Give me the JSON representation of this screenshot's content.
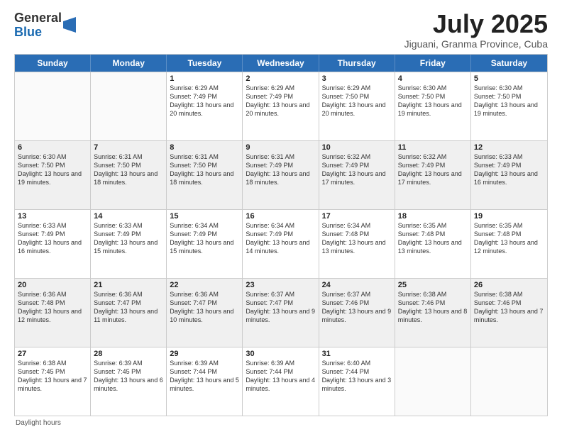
{
  "logo": {
    "general": "General",
    "blue": "Blue"
  },
  "title": "July 2025",
  "location": "Jiguani, Granma Province, Cuba",
  "days_of_week": [
    "Sunday",
    "Monday",
    "Tuesday",
    "Wednesday",
    "Thursday",
    "Friday",
    "Saturday"
  ],
  "footer_text": "Daylight hours",
  "weeks": [
    [
      {
        "day": "",
        "sunrise": "",
        "sunset": "",
        "daylight": "",
        "shaded": false,
        "empty": true
      },
      {
        "day": "",
        "sunrise": "",
        "sunset": "",
        "daylight": "",
        "shaded": false,
        "empty": true
      },
      {
        "day": "1",
        "sunrise": "Sunrise: 6:29 AM",
        "sunset": "Sunset: 7:49 PM",
        "daylight": "Daylight: 13 hours and 20 minutes.",
        "shaded": false,
        "empty": false
      },
      {
        "day": "2",
        "sunrise": "Sunrise: 6:29 AM",
        "sunset": "Sunset: 7:49 PM",
        "daylight": "Daylight: 13 hours and 20 minutes.",
        "shaded": false,
        "empty": false
      },
      {
        "day": "3",
        "sunrise": "Sunrise: 6:29 AM",
        "sunset": "Sunset: 7:50 PM",
        "daylight": "Daylight: 13 hours and 20 minutes.",
        "shaded": false,
        "empty": false
      },
      {
        "day": "4",
        "sunrise": "Sunrise: 6:30 AM",
        "sunset": "Sunset: 7:50 PM",
        "daylight": "Daylight: 13 hours and 19 minutes.",
        "shaded": false,
        "empty": false
      },
      {
        "day": "5",
        "sunrise": "Sunrise: 6:30 AM",
        "sunset": "Sunset: 7:50 PM",
        "daylight": "Daylight: 13 hours and 19 minutes.",
        "shaded": false,
        "empty": false
      }
    ],
    [
      {
        "day": "6",
        "sunrise": "Sunrise: 6:30 AM",
        "sunset": "Sunset: 7:50 PM",
        "daylight": "Daylight: 13 hours and 19 minutes.",
        "shaded": true,
        "empty": false
      },
      {
        "day": "7",
        "sunrise": "Sunrise: 6:31 AM",
        "sunset": "Sunset: 7:50 PM",
        "daylight": "Daylight: 13 hours and 18 minutes.",
        "shaded": true,
        "empty": false
      },
      {
        "day": "8",
        "sunrise": "Sunrise: 6:31 AM",
        "sunset": "Sunset: 7:50 PM",
        "daylight": "Daylight: 13 hours and 18 minutes.",
        "shaded": true,
        "empty": false
      },
      {
        "day": "9",
        "sunrise": "Sunrise: 6:31 AM",
        "sunset": "Sunset: 7:49 PM",
        "daylight": "Daylight: 13 hours and 18 minutes.",
        "shaded": true,
        "empty": false
      },
      {
        "day": "10",
        "sunrise": "Sunrise: 6:32 AM",
        "sunset": "Sunset: 7:49 PM",
        "daylight": "Daylight: 13 hours and 17 minutes.",
        "shaded": true,
        "empty": false
      },
      {
        "day": "11",
        "sunrise": "Sunrise: 6:32 AM",
        "sunset": "Sunset: 7:49 PM",
        "daylight": "Daylight: 13 hours and 17 minutes.",
        "shaded": true,
        "empty": false
      },
      {
        "day": "12",
        "sunrise": "Sunrise: 6:33 AM",
        "sunset": "Sunset: 7:49 PM",
        "daylight": "Daylight: 13 hours and 16 minutes.",
        "shaded": true,
        "empty": false
      }
    ],
    [
      {
        "day": "13",
        "sunrise": "Sunrise: 6:33 AM",
        "sunset": "Sunset: 7:49 PM",
        "daylight": "Daylight: 13 hours and 16 minutes.",
        "shaded": false,
        "empty": false
      },
      {
        "day": "14",
        "sunrise": "Sunrise: 6:33 AM",
        "sunset": "Sunset: 7:49 PM",
        "daylight": "Daylight: 13 hours and 15 minutes.",
        "shaded": false,
        "empty": false
      },
      {
        "day": "15",
        "sunrise": "Sunrise: 6:34 AM",
        "sunset": "Sunset: 7:49 PM",
        "daylight": "Daylight: 13 hours and 15 minutes.",
        "shaded": false,
        "empty": false
      },
      {
        "day": "16",
        "sunrise": "Sunrise: 6:34 AM",
        "sunset": "Sunset: 7:49 PM",
        "daylight": "Daylight: 13 hours and 14 minutes.",
        "shaded": false,
        "empty": false
      },
      {
        "day": "17",
        "sunrise": "Sunrise: 6:34 AM",
        "sunset": "Sunset: 7:48 PM",
        "daylight": "Daylight: 13 hours and 13 minutes.",
        "shaded": false,
        "empty": false
      },
      {
        "day": "18",
        "sunrise": "Sunrise: 6:35 AM",
        "sunset": "Sunset: 7:48 PM",
        "daylight": "Daylight: 13 hours and 13 minutes.",
        "shaded": false,
        "empty": false
      },
      {
        "day": "19",
        "sunrise": "Sunrise: 6:35 AM",
        "sunset": "Sunset: 7:48 PM",
        "daylight": "Daylight: 13 hours and 12 minutes.",
        "shaded": false,
        "empty": false
      }
    ],
    [
      {
        "day": "20",
        "sunrise": "Sunrise: 6:36 AM",
        "sunset": "Sunset: 7:48 PM",
        "daylight": "Daylight: 13 hours and 12 minutes.",
        "shaded": true,
        "empty": false
      },
      {
        "day": "21",
        "sunrise": "Sunrise: 6:36 AM",
        "sunset": "Sunset: 7:47 PM",
        "daylight": "Daylight: 13 hours and 11 minutes.",
        "shaded": true,
        "empty": false
      },
      {
        "day": "22",
        "sunrise": "Sunrise: 6:36 AM",
        "sunset": "Sunset: 7:47 PM",
        "daylight": "Daylight: 13 hours and 10 minutes.",
        "shaded": true,
        "empty": false
      },
      {
        "day": "23",
        "sunrise": "Sunrise: 6:37 AM",
        "sunset": "Sunset: 7:47 PM",
        "daylight": "Daylight: 13 hours and 9 minutes.",
        "shaded": true,
        "empty": false
      },
      {
        "day": "24",
        "sunrise": "Sunrise: 6:37 AM",
        "sunset": "Sunset: 7:46 PM",
        "daylight": "Daylight: 13 hours and 9 minutes.",
        "shaded": true,
        "empty": false
      },
      {
        "day": "25",
        "sunrise": "Sunrise: 6:38 AM",
        "sunset": "Sunset: 7:46 PM",
        "daylight": "Daylight: 13 hours and 8 minutes.",
        "shaded": true,
        "empty": false
      },
      {
        "day": "26",
        "sunrise": "Sunrise: 6:38 AM",
        "sunset": "Sunset: 7:46 PM",
        "daylight": "Daylight: 13 hours and 7 minutes.",
        "shaded": true,
        "empty": false
      }
    ],
    [
      {
        "day": "27",
        "sunrise": "Sunrise: 6:38 AM",
        "sunset": "Sunset: 7:45 PM",
        "daylight": "Daylight: 13 hours and 7 minutes.",
        "shaded": false,
        "empty": false
      },
      {
        "day": "28",
        "sunrise": "Sunrise: 6:39 AM",
        "sunset": "Sunset: 7:45 PM",
        "daylight": "Daylight: 13 hours and 6 minutes.",
        "shaded": false,
        "empty": false
      },
      {
        "day": "29",
        "sunrise": "Sunrise: 6:39 AM",
        "sunset": "Sunset: 7:44 PM",
        "daylight": "Daylight: 13 hours and 5 minutes.",
        "shaded": false,
        "empty": false
      },
      {
        "day": "30",
        "sunrise": "Sunrise: 6:39 AM",
        "sunset": "Sunset: 7:44 PM",
        "daylight": "Daylight: 13 hours and 4 minutes.",
        "shaded": false,
        "empty": false
      },
      {
        "day": "31",
        "sunrise": "Sunrise: 6:40 AM",
        "sunset": "Sunset: 7:44 PM",
        "daylight": "Daylight: 13 hours and 3 minutes.",
        "shaded": false,
        "empty": false
      },
      {
        "day": "",
        "sunrise": "",
        "sunset": "",
        "daylight": "",
        "shaded": false,
        "empty": true
      },
      {
        "day": "",
        "sunrise": "",
        "sunset": "",
        "daylight": "",
        "shaded": false,
        "empty": true
      }
    ]
  ]
}
